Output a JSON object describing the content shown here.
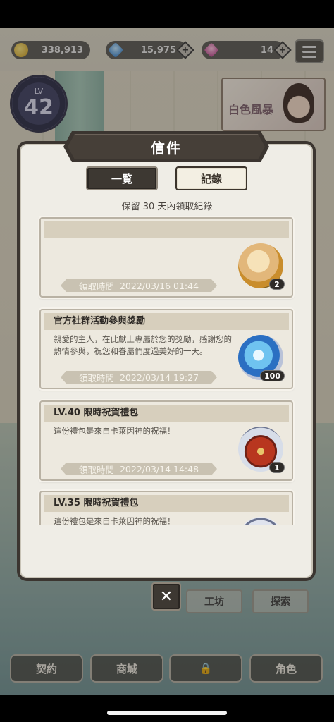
{
  "currencies": [
    {
      "icon": "gold-coin-icon",
      "value": "338,913"
    },
    {
      "icon": "blue-diamond-icon",
      "value": "15,975"
    },
    {
      "icon": "pink-gem-icon",
      "value": "14"
    }
  ],
  "level_badge": {
    "label": "LV",
    "value": "42"
  },
  "banner": {
    "logo": "白色風暴"
  },
  "dialog": {
    "title": "信件",
    "tabs": [
      {
        "label": "一覧",
        "active": true
      },
      {
        "label": "記錄",
        "active": false
      }
    ],
    "retention_note": "保留 30 天內領取紀錄",
    "mails": [
      {
        "title": "",
        "body": "",
        "claim_label": "領取時間",
        "claim_time": "2022/03/16 01:44",
        "reward_icon": "scroll-bundle-icon",
        "reward_qty": "2"
      },
      {
        "title": "官方社群活動參與獎勵",
        "body": "親愛的主人，在此獻上專屬於您的獎勵，感謝您的熱情參與，祝您和眷屬們度過美好的一天。",
        "claim_label": "領取時間",
        "claim_time": "2022/03/14 19:27",
        "reward_icon": "blue-diamond-icon",
        "reward_qty": "100"
      },
      {
        "title": "LV.40 限時祝賀禮包",
        "body": "這份禮包是來自卡萊因神的祝福！",
        "claim_label": "領取時間",
        "claim_time": "2022/03/14 14:48",
        "reward_icon": "treasure-chest-icon",
        "reward_qty": "1"
      },
      {
        "title": "LV.35 限時祝賀禮包",
        "body": "這份禮包是來自卡萊因神的祝福！",
        "claim_label": "",
        "claim_time": "",
        "reward_icon": "reward-icon",
        "reward_qty": ""
      }
    ],
    "close_symbol": "✕"
  },
  "bottom_nav": [
    "契約",
    "商城",
    "",
    "角色"
  ],
  "side_buttons": [
    "工坊",
    "探索"
  ],
  "colors": {
    "dialog_frame": "#3b3530",
    "dialog_bg": "#efede6",
    "card_header": "#d7cfbd"
  }
}
